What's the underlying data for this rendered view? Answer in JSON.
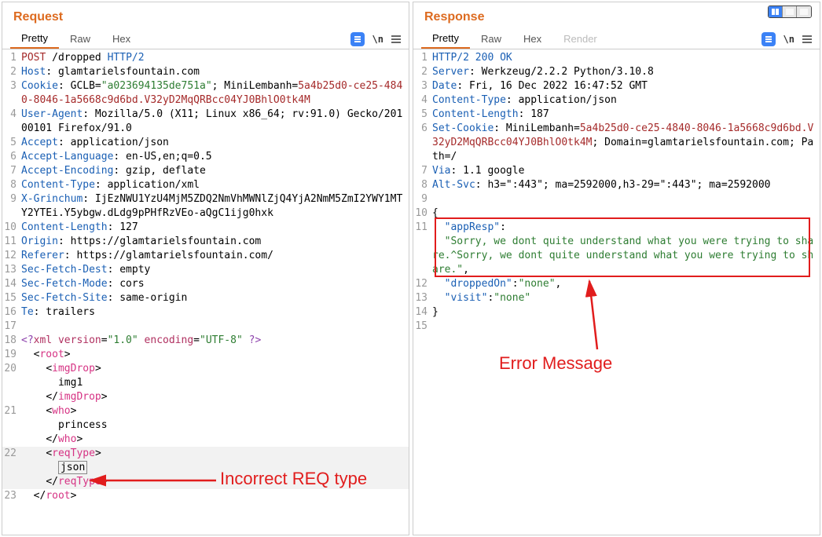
{
  "request": {
    "title": "Request",
    "tabs": {
      "pretty": "Pretty",
      "raw": "Raw",
      "hex": "Hex"
    },
    "lines": {
      "l1_method": "POST ",
      "l1_path": "/dropped ",
      "l1_proto": "HTTP/2",
      "l2_k": "Host",
      "l2_v": ": glamtarielsfountain.com",
      "l3_k": "Cookie",
      "l3_a": ": GCLB=",
      "l3_b": "\"a023694135de751a\"",
      "l3_c": "; MiniLembanh=",
      "l3_d": "5a4b25d0-ce25-4840-8046-1a5668c9d6bd.V32yD2MqQRBcc04YJ0BhlO0tk4M",
      "l4_k": "User-Agent",
      "l4_v": ": Mozilla/5.0 (X11; Linux x86_64; rv:91.0) Gecko/20100101 Firefox/91.0",
      "l5_k": "Accept",
      "l5_v": ": application/json",
      "l6_k": "Accept-Language",
      "l6_v": ": en-US,en;q=0.5",
      "l7_k": "Accept-Encoding",
      "l7_v": ": gzip, deflate",
      "l8_k": "Content-Type",
      "l8_v": ": application/xml",
      "l9_k": "X-Grinchum",
      "l9_v": ": IjEzNWU1YzU4MjM5ZDQ2NmVhMWNlZjQ4YjA2NmM5ZmI2YWY1MTY2YTEi.Y5ybgw.dLdg9pPHfRzVEo-aQgC1ijg0hxk",
      "l10_k": "Content-Length",
      "l10_v": ": 127",
      "l11_k": "Origin",
      "l11_v": ": https://glamtarielsfountain.com",
      "l12_k": "Referer",
      "l12_v": ": https://glamtarielsfountain.com/",
      "l13_k": "Sec-Fetch-Dest",
      "l13_v": ": empty",
      "l14_k": "Sec-Fetch-Mode",
      "l14_v": ": cors",
      "l15_k": "Sec-Fetch-Site",
      "l15_v": ": same-origin",
      "l16_k": "Te",
      "l16_v": ": trailers",
      "l18_a": "<?",
      "l18_b": "xml version",
      "l18_c": "=",
      "l18_d": "\"1.0\"",
      "l18_e": " encoding",
      "l18_f": "=",
      "l18_g": "\"UTF-8\"",
      "l18_h": " ?>",
      "l19": "root",
      "l20_a": "imgDrop",
      "l20_b": "      img1",
      "l21_a": "who",
      "l21_b": "      princess",
      "l22_a": "reqType",
      "l22_b": "json",
      "l23": "root"
    }
  },
  "response": {
    "title": "Response",
    "tabs": {
      "pretty": "Pretty",
      "raw": "Raw",
      "hex": "Hex",
      "render": "Render"
    },
    "lines": {
      "l1": "HTTP/2 200 OK",
      "l2_k": "Server",
      "l2_v": ": Werkzeug/2.2.2 Python/3.10.8",
      "l3_k": "Date",
      "l3_v": ": Fri, 16 Dec 2022 16:47:52 GMT",
      "l4_k": "Content-Type",
      "l4_v": ": application/json",
      "l5_k": "Content-Length",
      "l5_v": ": 187",
      "l6_k": "Set-Cookie",
      "l6_a": ": MiniLembanh=",
      "l6_b": "5a4b25d0-ce25-4840-8046-1a5668c9d6bd.V32yD2MqQRBcc04YJ0BhlO0tk4M",
      "l6_c": "; Domain=glamtarielsfountain.com; Path=/",
      "l7_k": "Via",
      "l7_v": ": 1.1 google",
      "l8_k": "Alt-Svc",
      "l8_v": ": h3=\":443\"; ma=2592000,h3-29=\":443\"; ma=2592000",
      "l10": "{",
      "l11_k": "  \"appResp\"",
      "l11_c": ":",
      "l11_v": "\"Sorry, we dont quite understand what you were trying to share.^Sorry, we dont quite understand what you were trying to share.\"",
      "l11_e": ",",
      "l12_k": "  \"droppedOn\"",
      "l12_c": ":",
      "l12_v": "\"none\"",
      "l12_e": ",",
      "l13_k": "  \"visit\"",
      "l13_c": ":",
      "l13_v": "\"none\"",
      "l14": "}"
    }
  },
  "annotations": {
    "incorrect_req": "Incorrect REQ type",
    "error_msg": "Error Message"
  }
}
